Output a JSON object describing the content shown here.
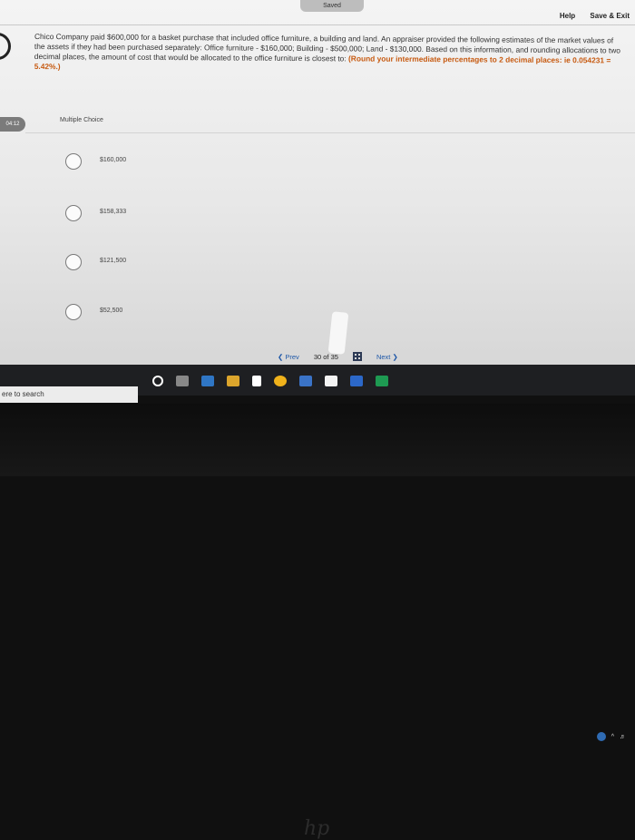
{
  "header": {
    "saved_label": "Saved",
    "help_label": "Help",
    "save_exit_label": "Save & Exit"
  },
  "question": {
    "text": "Chico Company paid $600,000 for a basket purchase that included office furniture, a building and land. An appraiser provided the following estimates of the market values of the assets if they had been purchased separately: Office furniture - $160,000; Building - $500,000; Land - $130,000. Based on this information, and rounding allocations to two decimal places, the amount of cost that would be allocated to the office furniture is closest to:",
    "instruction_bold": "(Round your intermediate percentages to 2 decimal places: ie 0.054231 = 5.42%.)"
  },
  "timer": "04:12",
  "choice_type_label": "Multiple Choice",
  "options": [
    "$160,000",
    "$158,333",
    "$121,500",
    "$52,500"
  ],
  "navigation": {
    "prev_label": "Prev",
    "current_page": "30",
    "of_label": "of",
    "total_pages": "35",
    "next_label": "Next"
  },
  "taskbar": {
    "search_text": "ere to search"
  },
  "monitor_brand": "hp"
}
